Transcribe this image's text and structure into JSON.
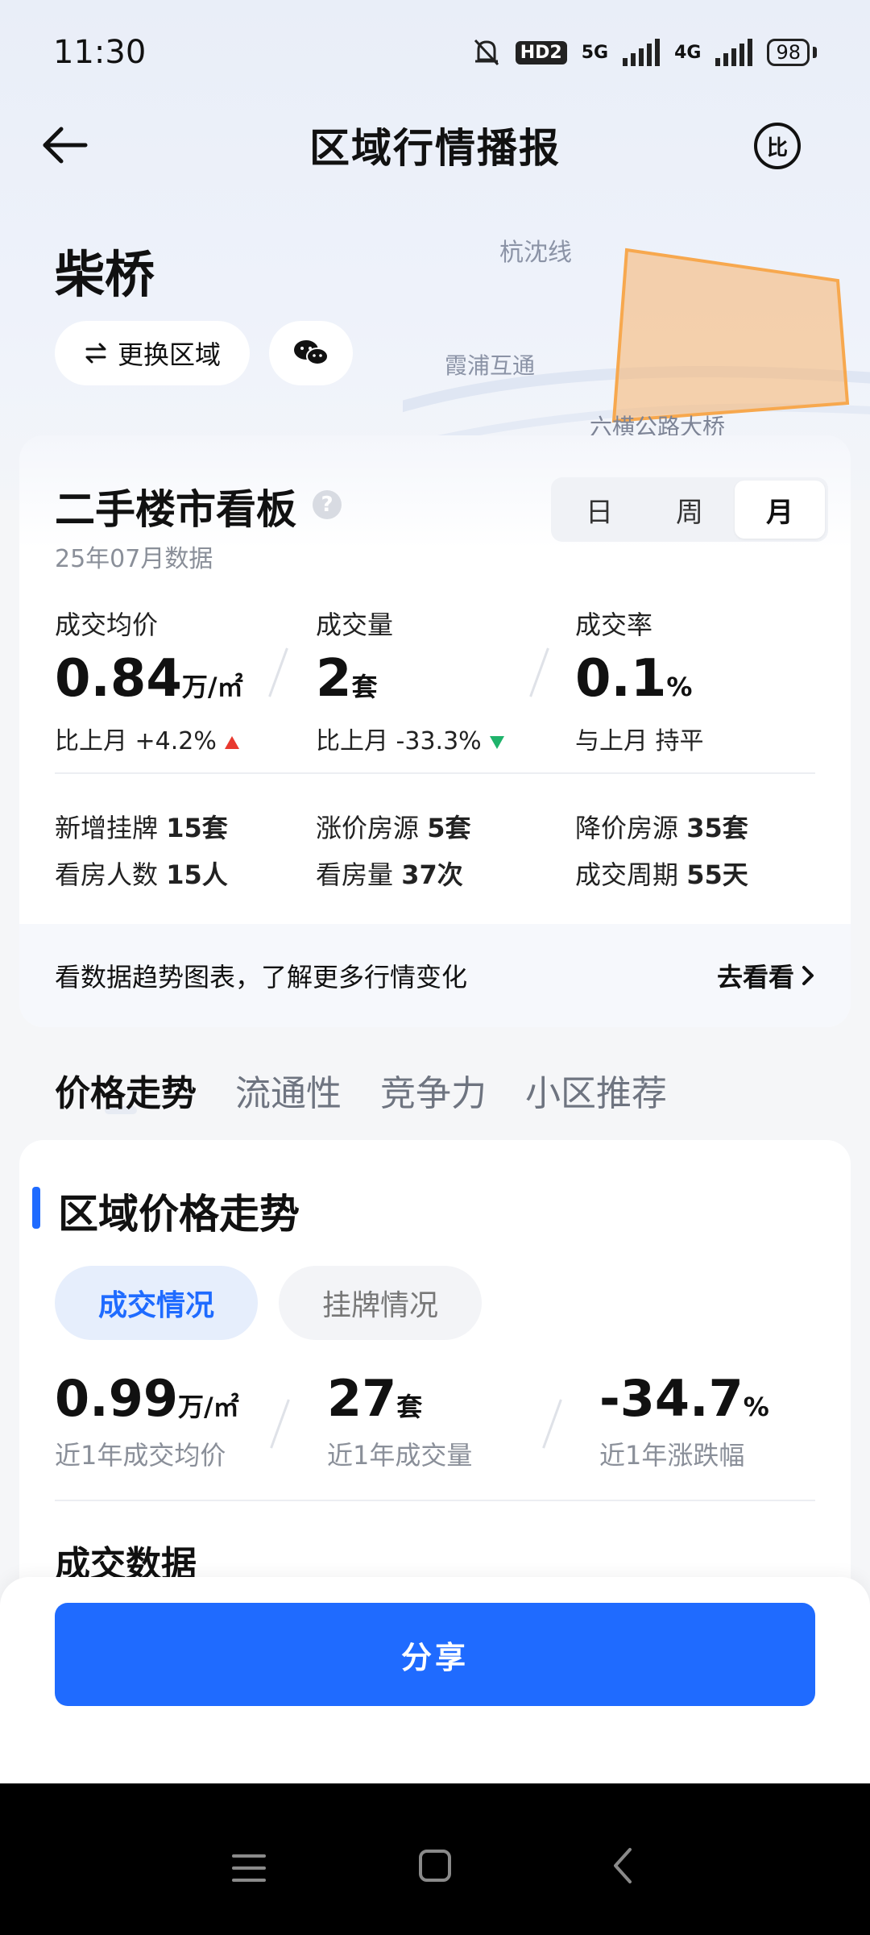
{
  "status_bar": {
    "time": "11:30",
    "hd_label": "HD2",
    "net_5g": "5G",
    "net_4g": "4G",
    "battery": "98"
  },
  "nav": {
    "title": "区域行情播报",
    "compare_icon_label": "比"
  },
  "map": {
    "labels": [
      "杭沈线",
      "霞浦互通",
      "六横公路大桥"
    ],
    "region_color": "#f7b26b"
  },
  "region": {
    "name": "柴桥",
    "change_label": "更换区域"
  },
  "board": {
    "title": "二手楼市看板",
    "subtitle": "25年07月数据",
    "periods": [
      {
        "label": "日"
      },
      {
        "label": "周"
      },
      {
        "label": "月"
      }
    ],
    "metrics": [
      {
        "label": "成交均价",
        "value": "0.84",
        "unit": "万/㎡",
        "change_prefix": "比上月",
        "change": "+4.2%",
        "trend": "up"
      },
      {
        "label": "成交量",
        "value": "2",
        "unit": "套",
        "change_prefix": "比上月",
        "change": "-33.3%",
        "trend": "down"
      },
      {
        "label": "成交率",
        "value": "0.1",
        "unit": "%",
        "change_prefix": "与上月",
        "change": "持平",
        "trend": "flat"
      }
    ],
    "stats": [
      {
        "label": "新增挂牌",
        "value": "15套"
      },
      {
        "label": "涨价房源",
        "value": "5套"
      },
      {
        "label": "降价房源",
        "value": "35套"
      },
      {
        "label": "看房人数",
        "value": "15人"
      },
      {
        "label": "看房量",
        "value": "37次"
      },
      {
        "label": "成交周期",
        "value": "55天"
      }
    ],
    "footer_text": "看数据趋势图表，了解更多行情变化",
    "footer_link": "去看看"
  },
  "section_tabs": [
    {
      "label": "价格走势"
    },
    {
      "label": "流通性"
    },
    {
      "label": "竞争力"
    },
    {
      "label": "小区推荐"
    }
  ],
  "trend": {
    "title": "区域价格走势",
    "pills": [
      {
        "label": "成交情况"
      },
      {
        "label": "挂牌情况"
      }
    ],
    "metrics": [
      {
        "value": "0.99",
        "unit": "万/㎡",
        "label": "近1年成交均价"
      },
      {
        "value": "27",
        "unit": "套",
        "label": "近1年成交量"
      },
      {
        "value": "-34.7",
        "unit": "%",
        "label": "近1年涨跌幅"
      }
    ],
    "sub_title": "成交数据"
  },
  "share": {
    "label": "分享"
  },
  "colors": {
    "accent": "#1f6bff",
    "up": "#e8392f",
    "down": "#1fb36b"
  }
}
